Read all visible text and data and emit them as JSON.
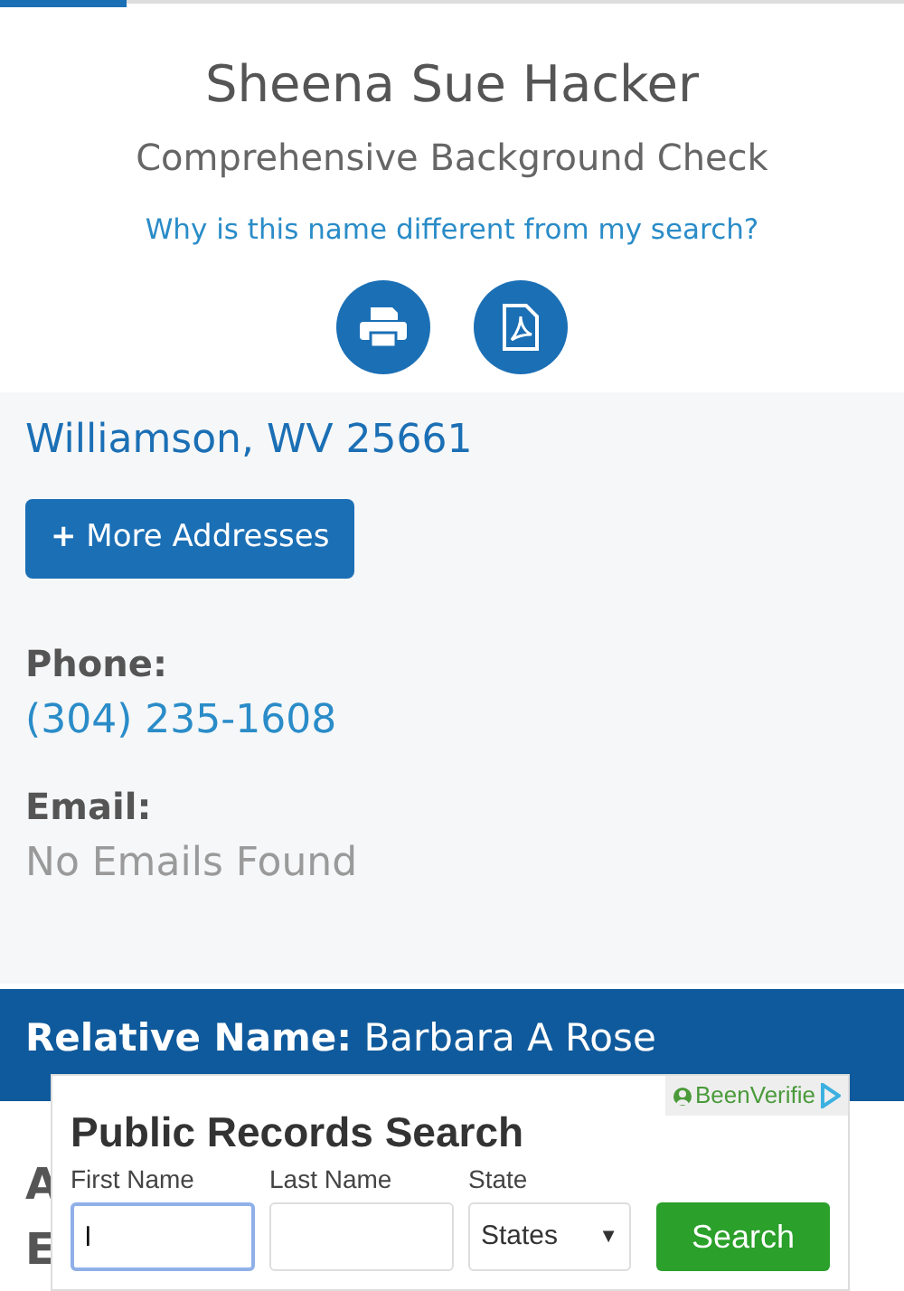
{
  "tabs": [
    {
      "selected": true
    },
    {
      "selected": false
    }
  ],
  "header": {
    "name": "Sheena Sue Hacker",
    "subtitle": "Comprehensive Background Check",
    "link": "Why is this name different from my search?"
  },
  "details": {
    "address": "Williamson, WV 25661",
    "more_button": {
      "icon": "+",
      "label": "More Addresses"
    },
    "fields": [
      {
        "label": "Phone:",
        "value": "(304) 235-1608",
        "found": true
      },
      {
        "label": "Email:",
        "value": "No Emails Found",
        "found": false
      }
    ]
  },
  "relative": {
    "label": "Relative Name:",
    "value": "Barbara A Rose"
  },
  "hidden_lines": [
    "A",
    "E"
  ],
  "ad": {
    "brand": "BeenVerifie",
    "title": "Public Records Search",
    "fields": [
      {
        "kind": "text",
        "label": "First Name",
        "value": "l",
        "focused": true
      },
      {
        "kind": "text",
        "label": "Last Name",
        "focused": false
      },
      {
        "kind": "select",
        "label": "State",
        "value": "States",
        "caret": "▼"
      }
    ],
    "button": "Search"
  }
}
